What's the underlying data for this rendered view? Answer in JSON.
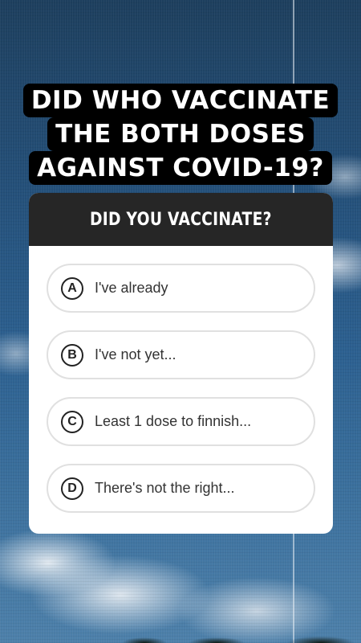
{
  "headline": {
    "lines": [
      "DID WHO VACCINATE",
      "THE BOTH DOSES",
      "AGAINST COVID-19?"
    ]
  },
  "quiz": {
    "question": "DID YOU VACCINATE?",
    "options": [
      {
        "letter": "A",
        "text": "I've already"
      },
      {
        "letter": "B",
        "text": "I've not yet..."
      },
      {
        "letter": "C",
        "text": "Least 1 dose to finnish..."
      },
      {
        "letter": "D",
        "text": "There's not the right..."
      }
    ]
  }
}
